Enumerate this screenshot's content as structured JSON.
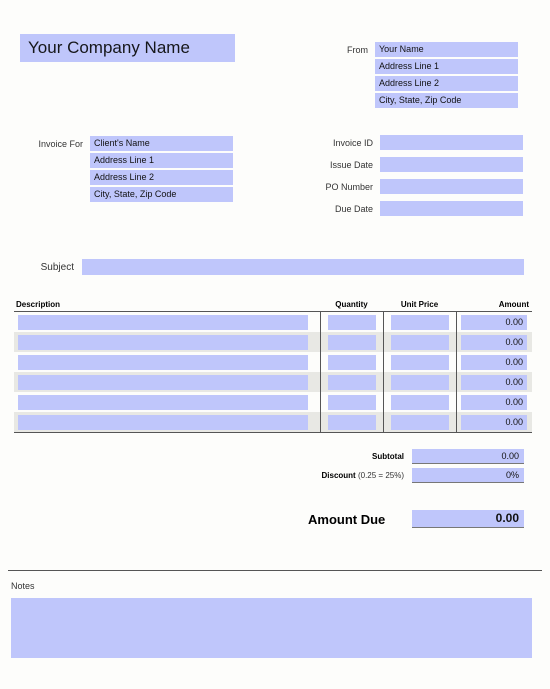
{
  "theme": {
    "field_fill": "#bfc6fb",
    "page_background": "#fdfdfb",
    "row_stripe": "#e8e8e4",
    "rule_color": "#555555"
  },
  "header": {
    "company_name": "Your Company Name",
    "company_name_placeholder": "Your Company Name"
  },
  "from": {
    "label": "From",
    "lines": [
      "Your Name",
      "Address Line 1",
      "Address Line 2",
      "City, State, Zip Code"
    ]
  },
  "invoice_for": {
    "label": "Invoice For",
    "lines": [
      "Client's Name",
      "Address Line 1",
      "Address Line 2",
      "City, State, Zip Code"
    ]
  },
  "meta": {
    "fields": [
      {
        "label": "Invoice ID",
        "value": ""
      },
      {
        "label": "Issue Date",
        "value": ""
      },
      {
        "label": "PO Number",
        "value": ""
      },
      {
        "label": "Due Date",
        "value": ""
      }
    ]
  },
  "subject": {
    "label": "Subject",
    "value": ""
  },
  "items": {
    "columns": [
      "Description",
      "Quantity",
      "Unit Price",
      "Amount"
    ],
    "rows": [
      {
        "description": "",
        "quantity": "",
        "unit_price": "",
        "amount": "0.00"
      },
      {
        "description": "",
        "quantity": "",
        "unit_price": "",
        "amount": "0.00"
      },
      {
        "description": "",
        "quantity": "",
        "unit_price": "",
        "amount": "0.00"
      },
      {
        "description": "",
        "quantity": "",
        "unit_price": "",
        "amount": "0.00"
      },
      {
        "description": "",
        "quantity": "",
        "unit_price": "",
        "amount": "0.00"
      },
      {
        "description": "",
        "quantity": "",
        "unit_price": "",
        "amount": "0.00"
      }
    ]
  },
  "totals": {
    "subtotal_label": "Subtotal",
    "subtotal_value": "0.00",
    "discount_label": "Discount",
    "discount_note": "(0.25 = 25%)",
    "discount_value": "0%",
    "amount_due_label": "Amount Due",
    "amount_due_value": "0.00"
  },
  "notes": {
    "label": "Notes",
    "value": ""
  }
}
